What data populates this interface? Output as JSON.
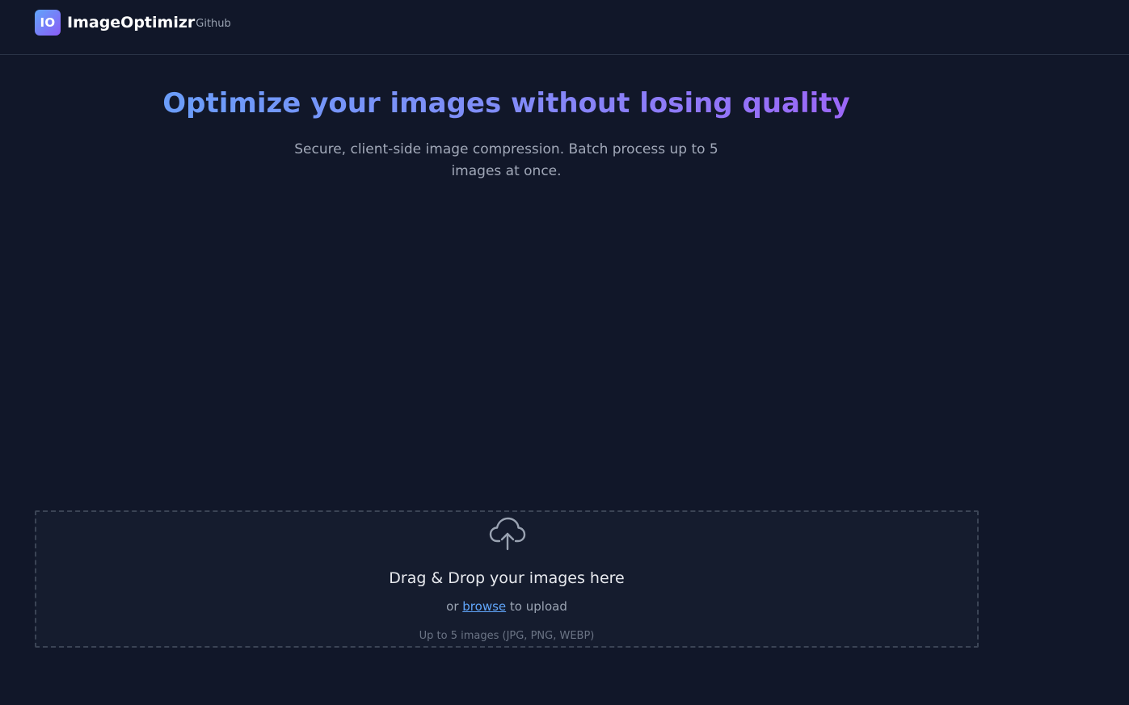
{
  "header": {
    "logo_text": "IO",
    "brand_name": "ImageOptimizr",
    "github_label": "Github"
  },
  "hero": {
    "title": "Optimize your images without losing quality",
    "subtitle": "Secure, client-side image compression. Batch process up to 5 images at once."
  },
  "dropzone": {
    "icon": "cloud-upload-icon",
    "title": "Drag & Drop your images here",
    "prefix": "or",
    "browse_label": "browse",
    "suffix": "to upload",
    "hint": "Up to 5 images (JPG, PNG, WEBP)"
  },
  "colors": {
    "background": "#111729",
    "accent_blue": "#60a5fa",
    "accent_purple": "#a855f7"
  }
}
